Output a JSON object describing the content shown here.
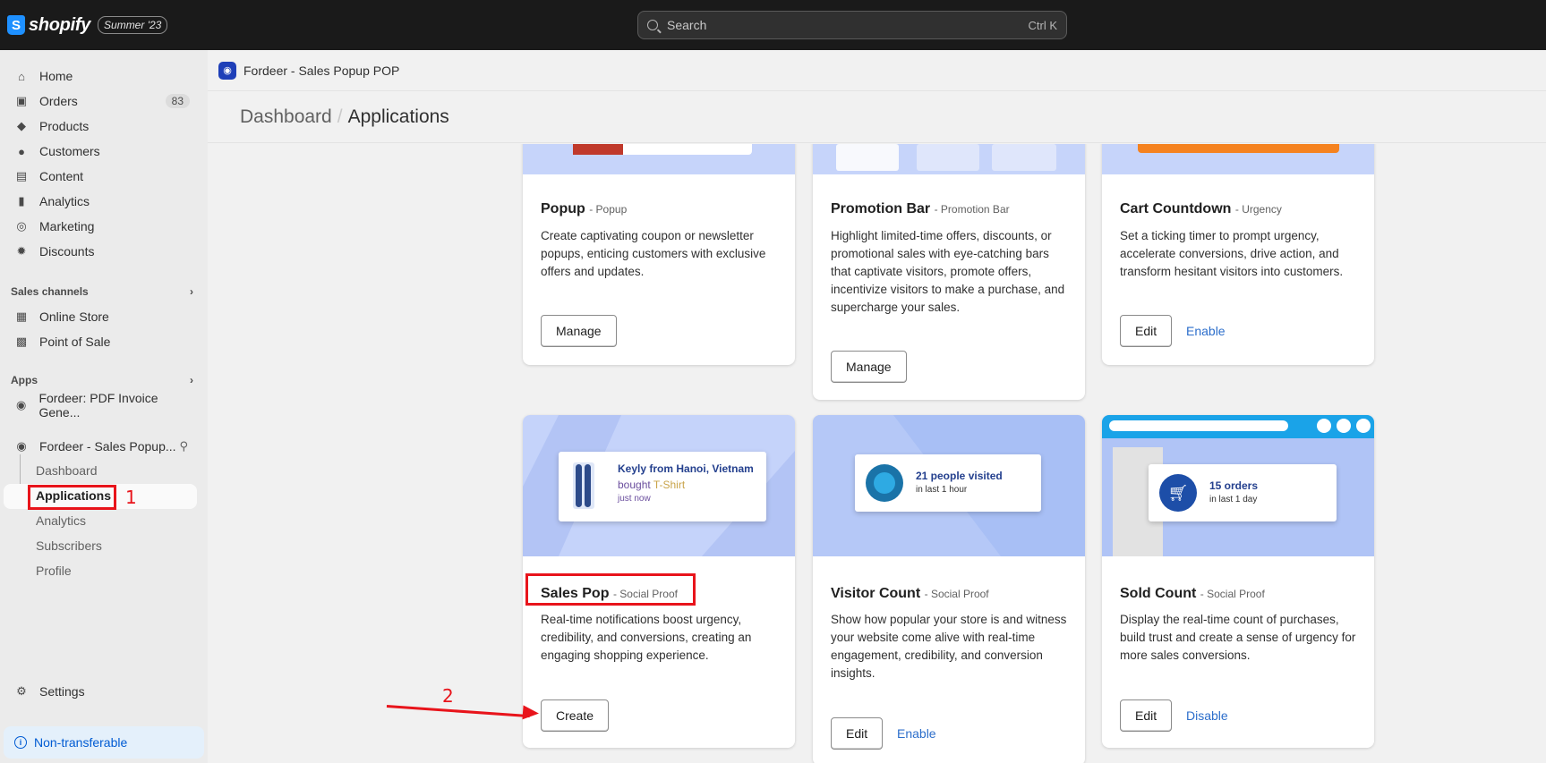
{
  "topbar": {
    "brand": "shopify",
    "edition": "Summer '23",
    "search_placeholder": "Search",
    "search_shortcut": "Ctrl K"
  },
  "sidebar": {
    "items": [
      {
        "label": "Home",
        "icon": "home-icon"
      },
      {
        "label": "Orders",
        "icon": "inbox-icon",
        "badge": "83"
      },
      {
        "label": "Products",
        "icon": "tag-icon"
      },
      {
        "label": "Customers",
        "icon": "person-icon"
      },
      {
        "label": "Content",
        "icon": "image-icon"
      },
      {
        "label": "Analytics",
        "icon": "bar-chart-icon"
      },
      {
        "label": "Marketing",
        "icon": "target-icon"
      },
      {
        "label": "Discounts",
        "icon": "discount-icon"
      }
    ],
    "sales_channels_title": "Sales channels",
    "sales_channels": [
      {
        "label": "Online Store",
        "icon": "store-icon"
      },
      {
        "label": "Point of Sale",
        "icon": "pos-icon"
      }
    ],
    "apps_title": "Apps",
    "apps": [
      {
        "label": "Fordeer: PDF Invoice Gene...",
        "icon": "fordeer-app-icon"
      },
      {
        "label": "Fordeer - Sales Popup...",
        "icon": "fordeer-app-icon"
      }
    ],
    "app_subitems": [
      "Dashboard",
      "Applications",
      "Analytics",
      "Subscribers",
      "Profile"
    ],
    "settings_label": "Settings",
    "non_transferable_label": "Non-transferable"
  },
  "annotations": {
    "step1": "1",
    "step2": "2"
  },
  "app_header": {
    "title": "Fordeer - Sales Popup POP"
  },
  "breadcrumb": {
    "parent": "Dashboard",
    "separator": "/",
    "current": "Applications"
  },
  "cards": [
    {
      "title": "Popup",
      "category": "- Popup",
      "description": "Create captivating coupon or newsletter popups, enticing customers with exclusive offers and updates.",
      "primary_button": "Manage"
    },
    {
      "title": "Promotion Bar",
      "category": "- Promotion Bar",
      "description": "Highlight limited-time offers, discounts, or promotional sales with eye-catching bars that captivate visitors, promote offers, incentivize visitors to make a purchase, and supercharge your sales.",
      "primary_button": "Manage"
    },
    {
      "title": "Cart Countdown",
      "category": "- Urgency",
      "description": "Set a ticking timer to prompt urgency, accelerate conversions, drive action, and transform hesitant visitors into customers.",
      "primary_button": "Edit",
      "link": "Enable"
    },
    {
      "title": "Sales Pop",
      "category": "- Social Proof",
      "description": "Real-time notifications boost urgency, credibility, and conversions, creating an engaging shopping experience.",
      "primary_button": "Create",
      "preview": {
        "name": "Keyly from Hanoi, Vietnam",
        "action": "bought",
        "product": "T-Shirt",
        "time": "just now"
      }
    },
    {
      "title": "Visitor Count",
      "category": "- Social Proof",
      "description": "Show how popular your store is and witness your website come alive with real-time engagement, credibility, and conversion insights.",
      "primary_button": "Edit",
      "link": "Enable",
      "preview": {
        "headline": "21 people visited",
        "sub": "in last 1 hour"
      }
    },
    {
      "title": "Sold Count",
      "category": "- Social Proof",
      "description": "Display the real-time count of purchases, build trust and create a sense of urgency for more sales conversions.",
      "primary_button": "Edit",
      "link": "Disable",
      "preview": {
        "headline": "15 orders",
        "sub": "in last 1 day"
      }
    }
  ],
  "colors": {
    "accent_blue": "#2c6ecb",
    "annotation_red": "#e8141b",
    "card_art_blue": "#b7c9f7"
  }
}
